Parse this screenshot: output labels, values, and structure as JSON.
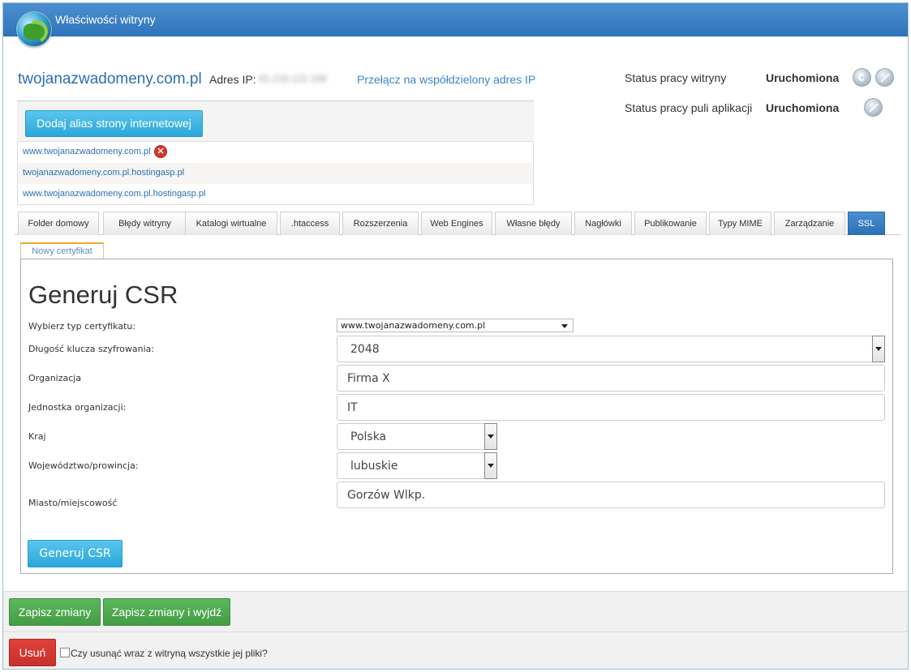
{
  "window": {
    "title": "Właściwości witryny"
  },
  "site": {
    "domain": "twojanazwadomeny.com.pl",
    "ip_label": "Adres IP:",
    "ip_value": "91.218.122.169",
    "switch_ip_link": "Przełącz na współdzielony adres IP"
  },
  "status": {
    "site_label": "Status pracy witryny",
    "site_value": "Uruchomiona",
    "pool_label": "Status pracy puli aplikacji",
    "pool_value": "Uruchomiona"
  },
  "aliases": {
    "add_button": "Dodaj alias strony internetowej",
    "items": [
      "www.twojanazwadomeny.com.pl",
      "twojanazwadomeny.com.pl.hostingasp.pl",
      "www.twojanazwadomeny.com.pl.hostingasp.pl"
    ]
  },
  "tabs": [
    "Folder domowy",
    "Błędy witryny",
    "Katalogi wirtualne",
    ".htaccess",
    "Rozszerzenia",
    "Web Engines",
    "Własne błędy",
    "Nagłówki",
    "Publikowanie",
    "Typy MIME",
    "Zarządzanie",
    "SSL"
  ],
  "active_tab": "SSL",
  "subtab": "Nowy certyfikat",
  "csr": {
    "title": "Generuj CSR",
    "cert_type_label": "Wybierz typ certyfikatu:",
    "cert_type_value": "www.twojanazwadomeny.com.pl",
    "key_length_label": "Długość klucza szyfrowania:",
    "key_length_value": "2048",
    "org_label": "Organizacja",
    "org_value": "Firma X",
    "unit_label": "Jednostka organizacji:",
    "unit_value": "IT",
    "country_label": "Kraj",
    "country_value": "Polska",
    "province_label": "Województwo/prowincja:",
    "province_value": "lubuskie",
    "city_label": "Miasto/miejscowość",
    "city_value": "Gorzów Wlkp.",
    "generate_button": "Generuj CSR"
  },
  "footer": {
    "save": "Zapisz zmiany",
    "save_exit": "Zapisz zmiany i wyjdź",
    "delete": "Usuń",
    "delete_files_label": "Czy usunąć wraz z witryną wszystkie jej pliki?"
  },
  "colors": {
    "accent": "#2f73bb",
    "button_blue": "#2aa7da",
    "button_green": "#449d44",
    "button_red": "#c9302c"
  }
}
